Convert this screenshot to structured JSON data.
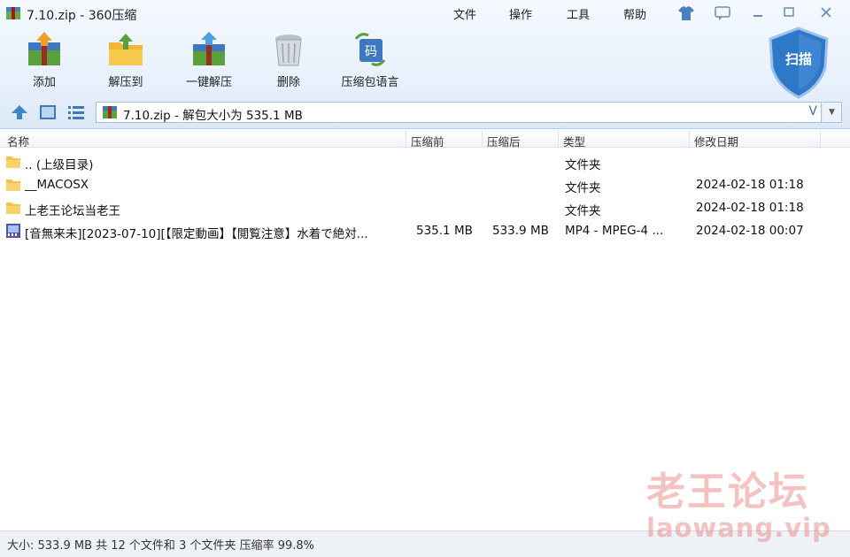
{
  "window": {
    "title": "7.10.zip - 360压缩"
  },
  "menu": {
    "file": "文件",
    "operate": "操作",
    "tools": "工具",
    "help": "帮助"
  },
  "toolbar": {
    "add": "添加",
    "extract_to": "解压到",
    "one_click_extract": "一键解压",
    "delete": "删除",
    "archive_language": "压缩包语言",
    "lang_badge": "码",
    "scan": "扫描"
  },
  "address": {
    "text": "7.10.zip - 解包大小为 535.1 MB",
    "v_glyph": "V"
  },
  "columns": {
    "name": "名称",
    "before": "压缩前",
    "after": "压缩后",
    "type": "类型",
    "modified": "修改日期"
  },
  "rows": [
    {
      "name": ".. (上级目录)",
      "before": "",
      "after": "",
      "type": "文件夹",
      "modified": "",
      "icon": "folder-icon"
    },
    {
      "name": "__MACOSX",
      "before": "",
      "after": "",
      "type": "文件夹",
      "modified": "2024-02-18 01:18",
      "icon": "folder-icon"
    },
    {
      "name": "上老王论坛当老王",
      "before": "",
      "after": "",
      "type": "文件夹",
      "modified": "2024-02-18 01:18",
      "icon": "folder-icon"
    },
    {
      "name": "[音無来未][2023-07-10][【限定動画】【閲覧注意】水着で絶対...",
      "before": "535.1 MB",
      "after": "533.9 MB",
      "type": "MP4 - MPEG-4 ...",
      "modified": "2024-02-18 00:07",
      "icon": "video-file-icon"
    }
  ],
  "status": {
    "text": "大小: 533.9 MB 共 12 个文件和 3 个文件夹 压缩率 99.8%"
  },
  "watermark": {
    "cn": "老王论坛",
    "en": "laowang.vip"
  },
  "colors": {
    "chrome_bg": "#e6f0fb",
    "folder": "#f5c24a",
    "scan_shield": "#2f78c8",
    "watermark": "#e87878"
  }
}
